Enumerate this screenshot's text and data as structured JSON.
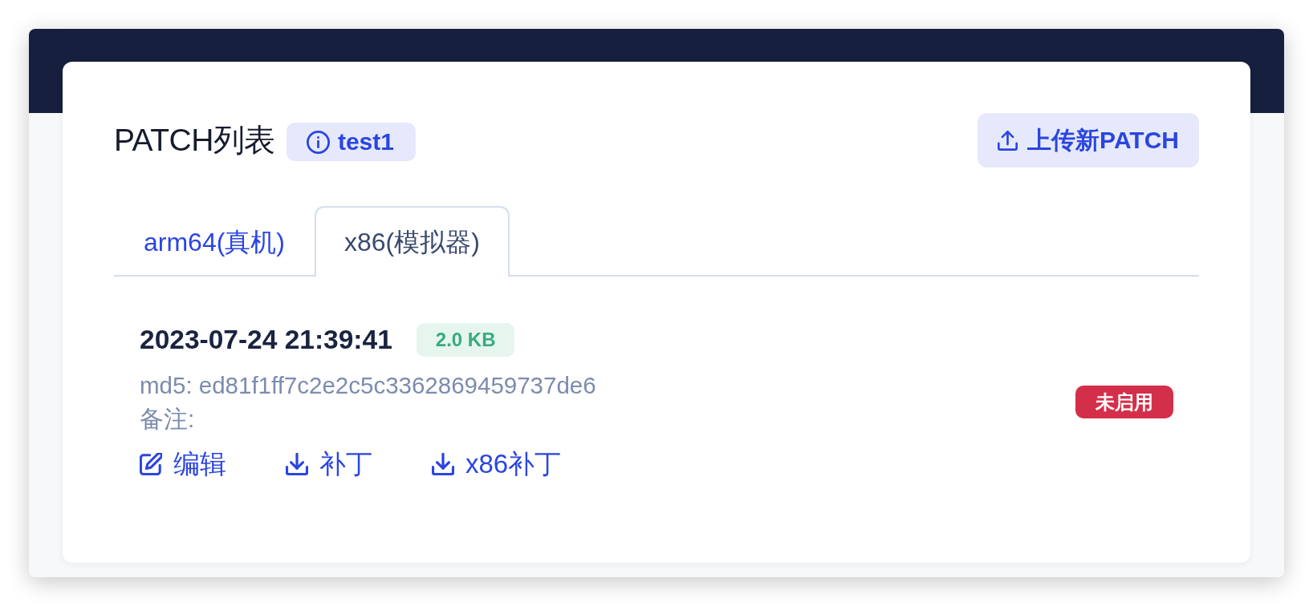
{
  "header": {
    "title": "PATCH列表",
    "app_badge": "test1",
    "upload_button": "上传新PATCH"
  },
  "tabs": [
    {
      "label": "arm64(真机)",
      "selected": false
    },
    {
      "label": "x86(模拟器)",
      "selected": true
    }
  ],
  "patches": [
    {
      "time": "2023-07-24 21:39:41",
      "size": "2.0 KB",
      "md5": "md5: ed81f1ff7c2e2c5c3362869459737de6",
      "note": "备注:",
      "status": "未启用",
      "enabled": false,
      "actions": [
        {
          "kind": "edit",
          "label": "编辑"
        },
        {
          "kind": "download",
          "label": "补丁"
        },
        {
          "kind": "download",
          "label": "x86补丁"
        }
      ]
    }
  ]
}
